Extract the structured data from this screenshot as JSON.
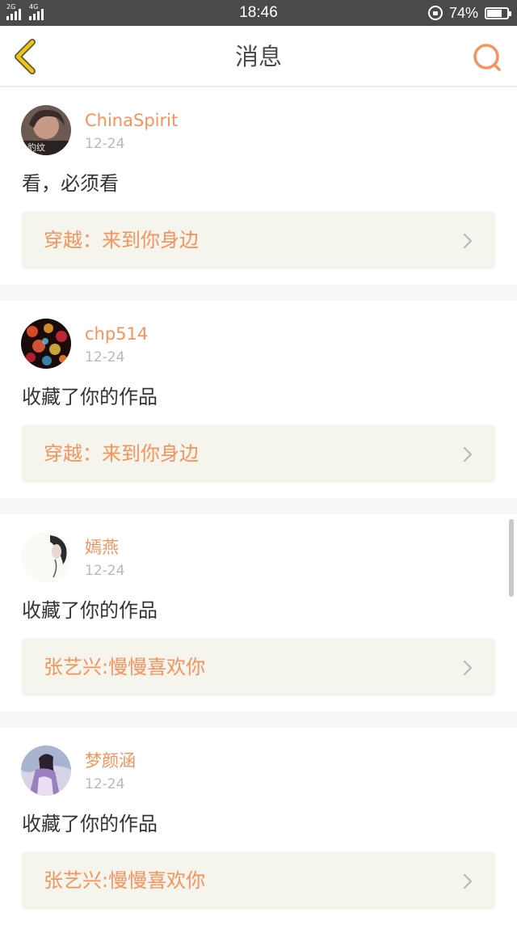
{
  "status_bar": {
    "network_1": "2G",
    "network_2": "4G",
    "time": "18:46",
    "battery": "74%",
    "battery_level": 0.74
  },
  "header": {
    "title": "消息",
    "back_icon": "chevron-left-icon",
    "search_icon": "search-icon"
  },
  "colors": {
    "accent": "#f4935c",
    "back_icon": "#f0c419",
    "card_bg": "#f5f5ee",
    "separator": "#f7f5f7"
  },
  "messages": [
    {
      "username": "ChinaSpirit",
      "date": "12-24",
      "text": "看，必须看",
      "work": "穿越：来到你身边",
      "avatar_caption": "豹纹"
    },
    {
      "username": "chp514",
      "date": "12-24",
      "text": "收藏了你的作品",
      "work": "穿越：来到你身边"
    },
    {
      "username": "嫣燕",
      "date": "12-24",
      "text": "收藏了你的作品",
      "work": "张艺兴:慢慢喜欢你"
    },
    {
      "username": "梦颜涵",
      "date": "12-24",
      "text": "收藏了你的作品",
      "work": "张艺兴:慢慢喜欢你"
    }
  ]
}
